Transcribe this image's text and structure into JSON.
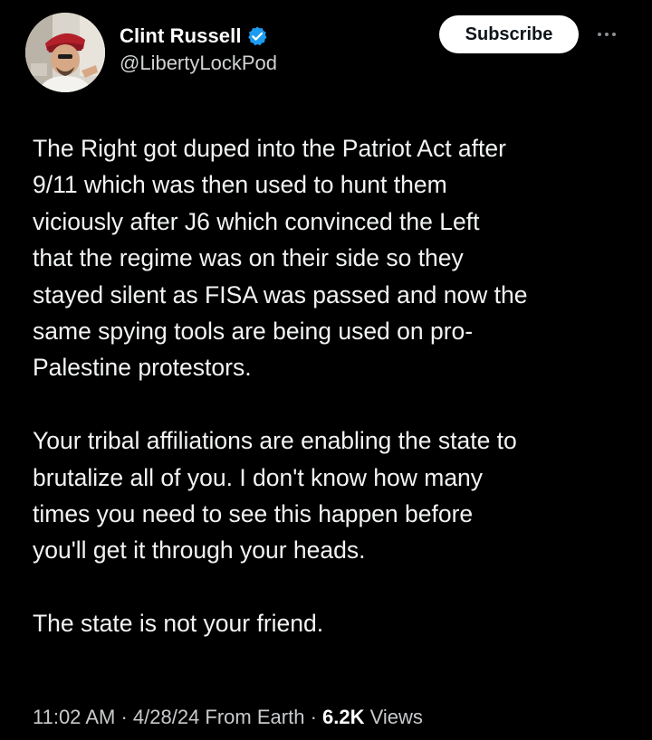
{
  "author": {
    "name": "Clint Russell",
    "handle": "@LibertyLockPod",
    "verified": true,
    "verified_color": "#1d9bf0"
  },
  "actions": {
    "subscribe_label": "Subscribe",
    "more_icon": "more-horizontal-icon"
  },
  "tweet": {
    "paragraphs": [
      "The Right got duped into the Patriot Act after\n9/11 which was then used to hunt them\nviciously after J6 which convinced the Left\nthat the regime was on their side so they\nstayed silent as FISA was passed and now the\nsame spying tools are being used on pro-\nPalestine protestors.",
      "Your tribal affiliations are enabling the state to\nbrutalize all of you. I don't know how many\ntimes you need to see this happen before\nyou'll get it through your heads.",
      "The state is not your friend."
    ]
  },
  "meta": {
    "time": "11:02 AM",
    "separator": " · ",
    "date": "4/28/24",
    "location": "From Earth",
    "views_count": "6.2K",
    "views_label": "Views"
  },
  "colors": {
    "background": "#000000",
    "text": "#f2f3f4",
    "muted": "#c8cacc",
    "button_bg": "#ffffff",
    "button_text": "#0f1419"
  }
}
